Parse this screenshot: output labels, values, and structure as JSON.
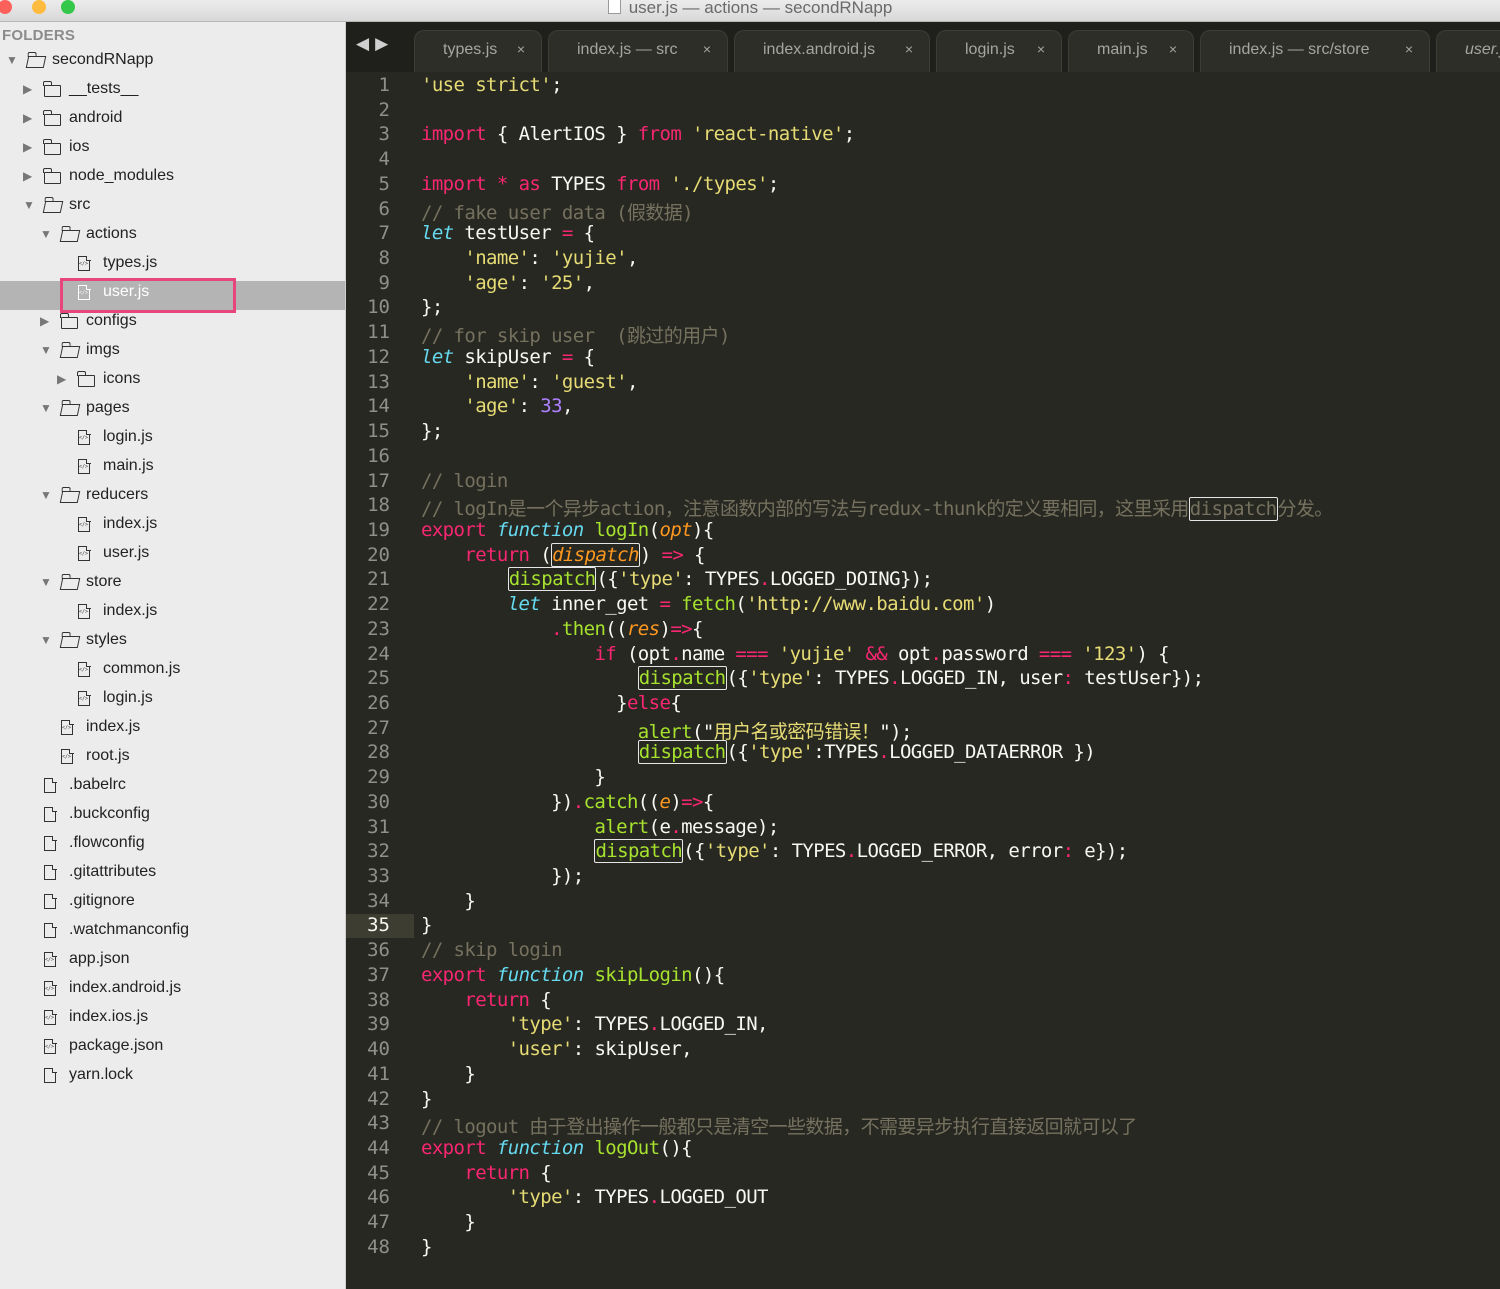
{
  "window": {
    "title": "user.js — actions — secondRNapp",
    "traffic_lights": {
      "close": "#fc605b",
      "minimize": "#fdbc40",
      "zoom": "#34c84a"
    }
  },
  "sidebar": {
    "header": "FOLDERS",
    "items": [
      {
        "label": "secondRNapp",
        "type": "folder-open"
      },
      {
        "label": "__tests__",
        "type": "folder"
      },
      {
        "label": "android",
        "type": "folder"
      },
      {
        "label": "ios",
        "type": "folder"
      },
      {
        "label": "node_modules",
        "type": "folder"
      },
      {
        "label": "src",
        "type": "folder-open"
      },
      {
        "label": "actions",
        "type": "folder-open"
      },
      {
        "label": "types.js",
        "type": "file-js"
      },
      {
        "label": "user.js",
        "type": "file-js",
        "selected": true
      },
      {
        "label": "configs",
        "type": "folder"
      },
      {
        "label": "imgs",
        "type": "folder-open"
      },
      {
        "label": "icons",
        "type": "folder"
      },
      {
        "label": "pages",
        "type": "folder-open"
      },
      {
        "label": "login.js",
        "type": "file-js"
      },
      {
        "label": "main.js",
        "type": "file-js"
      },
      {
        "label": "reducers",
        "type": "folder-open"
      },
      {
        "label": "index.js",
        "type": "file-js"
      },
      {
        "label": "user.js",
        "type": "file-js"
      },
      {
        "label": "store",
        "type": "folder-open"
      },
      {
        "label": "index.js",
        "type": "file-js"
      },
      {
        "label": "styles",
        "type": "folder-open"
      },
      {
        "label": "common.js",
        "type": "file-js"
      },
      {
        "label": "login.js",
        "type": "file-js"
      },
      {
        "label": "index.js",
        "type": "file-js"
      },
      {
        "label": "root.js",
        "type": "file-js"
      },
      {
        "label": ".babelrc",
        "type": "file"
      },
      {
        "label": ".buckconfig",
        "type": "file"
      },
      {
        "label": ".flowconfig",
        "type": "file"
      },
      {
        "label": ".gitattributes",
        "type": "file"
      },
      {
        "label": ".gitignore",
        "type": "file"
      },
      {
        "label": ".watchmanconfig",
        "type": "file"
      },
      {
        "label": "app.json",
        "type": "file-js"
      },
      {
        "label": "index.android.js",
        "type": "file-js"
      },
      {
        "label": "index.ios.js",
        "type": "file-js"
      },
      {
        "label": "package.json",
        "type": "file-js"
      },
      {
        "label": "yarn.lock",
        "type": "file"
      }
    ]
  },
  "tabbar": {
    "nav_back": "◀",
    "nav_forward": "▶",
    "close_glyph": "×",
    "tabs": [
      "types.js",
      "index.js — src",
      "index.android.js",
      "login.js",
      "main.js",
      "index.js — src/store",
      "user.js"
    ]
  },
  "editor": {
    "active_line": 35,
    "line_count": 48,
    "lines": [
      [
        [
          "st",
          "'use strict'"
        ],
        [
          "",
          "; "
        ]
      ],
      [],
      [
        [
          "kw",
          "import"
        ],
        [
          "",
          " { AlertIOS } "
        ],
        [
          "kw",
          "from"
        ],
        [
          "",
          " "
        ],
        [
          "st",
          "'react-native'"
        ],
        [
          "",
          ";"
        ]
      ],
      [],
      [
        [
          "kw",
          "import"
        ],
        [
          "",
          " "
        ],
        [
          "kw",
          "*"
        ],
        [
          "",
          " "
        ],
        [
          "kw",
          "as"
        ],
        [
          "",
          " TYPES "
        ],
        [
          "kw",
          "from"
        ],
        [
          "",
          " "
        ],
        [
          "st",
          "'./types'"
        ],
        [
          "",
          ";"
        ]
      ],
      [
        [
          "cm",
          "// fake user data (假数据)"
        ]
      ],
      [
        [
          "tp",
          "let"
        ],
        [
          "",
          " testUser "
        ],
        [
          "kw",
          "="
        ],
        [
          "",
          " {"
        ]
      ],
      [
        [
          "",
          "    "
        ],
        [
          "st",
          "'name'"
        ],
        [
          "",
          ": "
        ],
        [
          "st",
          "'yujie'"
        ],
        [
          "",
          ","
        ]
      ],
      [
        [
          "",
          "    "
        ],
        [
          "st",
          "'age'"
        ],
        [
          "",
          ": "
        ],
        [
          "st",
          "'25'"
        ],
        [
          "",
          ","
        ]
      ],
      [
        [
          "",
          "};"
        ]
      ],
      [
        [
          "cm",
          "// for skip user  (跳过的用户)"
        ]
      ],
      [
        [
          "tp",
          "let"
        ],
        [
          "",
          " skipUser "
        ],
        [
          "kw",
          "="
        ],
        [
          "",
          " {"
        ]
      ],
      [
        [
          "",
          "    "
        ],
        [
          "st",
          "'name'"
        ],
        [
          "",
          ": "
        ],
        [
          "st",
          "'guest'"
        ],
        [
          "",
          ","
        ]
      ],
      [
        [
          "",
          "    "
        ],
        [
          "st",
          "'age'"
        ],
        [
          "",
          ": "
        ],
        [
          "nm",
          "33"
        ],
        [
          "",
          ","
        ]
      ],
      [
        [
          "",
          "};"
        ]
      ],
      [],
      [
        [
          "cm",
          "// login"
        ]
      ],
      [
        [
          "cm",
          "// logIn是一个异步action，注意函数内部的写法与redux-thunk的定义要相同，这里采用"
        ],
        [
          "cm hl",
          "dispatch"
        ],
        [
          "cm",
          "分发。"
        ]
      ],
      [
        [
          "kw",
          "export"
        ],
        [
          "",
          " "
        ],
        [
          "tp",
          "function"
        ],
        [
          "",
          " "
        ],
        [
          "fn",
          "logIn"
        ],
        [
          "",
          "("
        ],
        [
          "pa",
          "opt"
        ],
        [
          "",
          "){"
        ]
      ],
      [
        [
          "",
          "    "
        ],
        [
          "kw",
          "return"
        ],
        [
          "",
          " ("
        ],
        [
          "hl-cur",
          "dispatch"
        ],
        [
          "",
          ") "
        ],
        [
          "kw",
          "=>"
        ],
        [
          "",
          " {"
        ]
      ],
      [
        [
          "",
          "        "
        ],
        [
          "fn hl",
          "dispatch"
        ],
        [
          "",
          "({"
        ],
        [
          "st",
          "'type'"
        ],
        [
          "",
          ": TYPES"
        ],
        [
          "kw",
          "."
        ],
        [
          "",
          "LOGGED_DOING});"
        ]
      ],
      [
        [
          "",
          "        "
        ],
        [
          "tp",
          "let"
        ],
        [
          "",
          " inner_get "
        ],
        [
          "kw",
          "="
        ],
        [
          "",
          " "
        ],
        [
          "fn",
          "fetch"
        ],
        [
          "",
          "("
        ],
        [
          "st",
          "'http://www.baidu.com'"
        ],
        [
          "",
          ")"
        ]
      ],
      [
        [
          "",
          "            "
        ],
        [
          "kw",
          "."
        ],
        [
          "fn",
          "then"
        ],
        [
          "",
          "(("
        ],
        [
          "pa",
          "res"
        ],
        [
          "",
          ")"
        ],
        [
          "kw",
          "=>"
        ],
        [
          "",
          "{"
        ]
      ],
      [
        [
          "",
          "                "
        ],
        [
          "kw",
          "if"
        ],
        [
          "",
          " (opt"
        ],
        [
          "kw",
          "."
        ],
        [
          "",
          "name "
        ],
        [
          "kw",
          "==="
        ],
        [
          "",
          " "
        ],
        [
          "st",
          "'yujie'"
        ],
        [
          "",
          " "
        ],
        [
          "kw",
          "&&"
        ],
        [
          "",
          " opt"
        ],
        [
          "kw",
          "."
        ],
        [
          "",
          "password "
        ],
        [
          "kw",
          "==="
        ],
        [
          "",
          " "
        ],
        [
          "st",
          "'123'"
        ],
        [
          "",
          ") {"
        ]
      ],
      [
        [
          "",
          "                    "
        ],
        [
          "fn hl",
          "dispatch"
        ],
        [
          "",
          "({"
        ],
        [
          "st",
          "'type'"
        ],
        [
          "",
          ": TYPES"
        ],
        [
          "kw",
          "."
        ],
        [
          "",
          "LOGGED_IN, "
        ],
        [
          "",
          "user"
        ],
        [
          "kw",
          ":"
        ],
        [
          "",
          " testUser});"
        ]
      ],
      [
        [
          "",
          "                  }"
        ],
        [
          "kw",
          "else"
        ],
        [
          "",
          "{"
        ]
      ],
      [
        [
          "",
          "                    "
        ],
        [
          "fn",
          "alert"
        ],
        [
          "",
          "(\""
        ],
        [
          "st",
          "用户名或密码错误！"
        ],
        [
          "",
          "\");"
        ]
      ],
      [
        [
          "",
          "                    "
        ],
        [
          "fn hl",
          "dispatch"
        ],
        [
          "",
          "({"
        ],
        [
          "st",
          "'type'"
        ],
        [
          "",
          ":TYPES"
        ],
        [
          "kw",
          "."
        ],
        [
          "",
          "LOGGED_DATAERROR })"
        ]
      ],
      [
        [
          "",
          "                }"
        ]
      ],
      [
        [
          "",
          "            })"
        ],
        [
          "kw",
          "."
        ],
        [
          "fn",
          "catch"
        ],
        [
          "",
          "(("
        ],
        [
          "pa",
          "e"
        ],
        [
          "",
          ")"
        ],
        [
          "kw",
          "=>"
        ],
        [
          "",
          "{"
        ]
      ],
      [
        [
          "",
          "                "
        ],
        [
          "fn",
          "alert"
        ],
        [
          "",
          "(e"
        ],
        [
          "kw",
          "."
        ],
        [
          "",
          "message);"
        ]
      ],
      [
        [
          "",
          "                "
        ],
        [
          "fn hl",
          "dispatch"
        ],
        [
          "",
          "({"
        ],
        [
          "st",
          "'type'"
        ],
        [
          "",
          ": TYPES"
        ],
        [
          "kw",
          "."
        ],
        [
          "",
          "LOGGED_ERROR, "
        ],
        [
          "",
          "error"
        ],
        [
          "kw",
          ":"
        ],
        [
          "",
          " e});"
        ]
      ],
      [
        [
          "",
          "            });"
        ]
      ],
      [
        [
          "",
          "    }"
        ]
      ],
      [
        [
          "",
          "}"
        ]
      ],
      [
        [
          "cm",
          "// skip login"
        ]
      ],
      [
        [
          "kw",
          "export"
        ],
        [
          "",
          " "
        ],
        [
          "tp",
          "function"
        ],
        [
          "",
          " "
        ],
        [
          "fn",
          "skipLogin"
        ],
        [
          "",
          "(){"
        ]
      ],
      [
        [
          "",
          "    "
        ],
        [
          "kw",
          "return"
        ],
        [
          "",
          " {"
        ]
      ],
      [
        [
          "",
          "        "
        ],
        [
          "st",
          "'type'"
        ],
        [
          "",
          ": TYPES"
        ],
        [
          "kw",
          "."
        ],
        [
          "",
          "LOGGED_IN,"
        ]
      ],
      [
        [
          "",
          "        "
        ],
        [
          "st",
          "'user'"
        ],
        [
          "",
          ": skipUser,"
        ]
      ],
      [
        [
          "",
          "    }"
        ]
      ],
      [
        [
          "",
          "}"
        ]
      ],
      [
        [
          "cm",
          "// logout 由于登出操作一般都只是清空一些数据，不需要异步执行直接返回就可以了"
        ]
      ],
      [
        [
          "kw",
          "export"
        ],
        [
          "",
          " "
        ],
        [
          "tp",
          "function"
        ],
        [
          "",
          " "
        ],
        [
          "fn",
          "logOut"
        ],
        [
          "",
          "(){"
        ]
      ],
      [
        [
          "",
          "    "
        ],
        [
          "kw",
          "return"
        ],
        [
          "",
          " {"
        ]
      ],
      [
        [
          "",
          "        "
        ],
        [
          "st",
          "'type'"
        ],
        [
          "",
          ": TYPES"
        ],
        [
          "kw",
          "."
        ],
        [
          "",
          "LOGGED_OUT"
        ]
      ],
      [
        [
          "",
          "    }"
        ]
      ],
      [
        [
          "",
          "}"
        ]
      ]
    ]
  }
}
